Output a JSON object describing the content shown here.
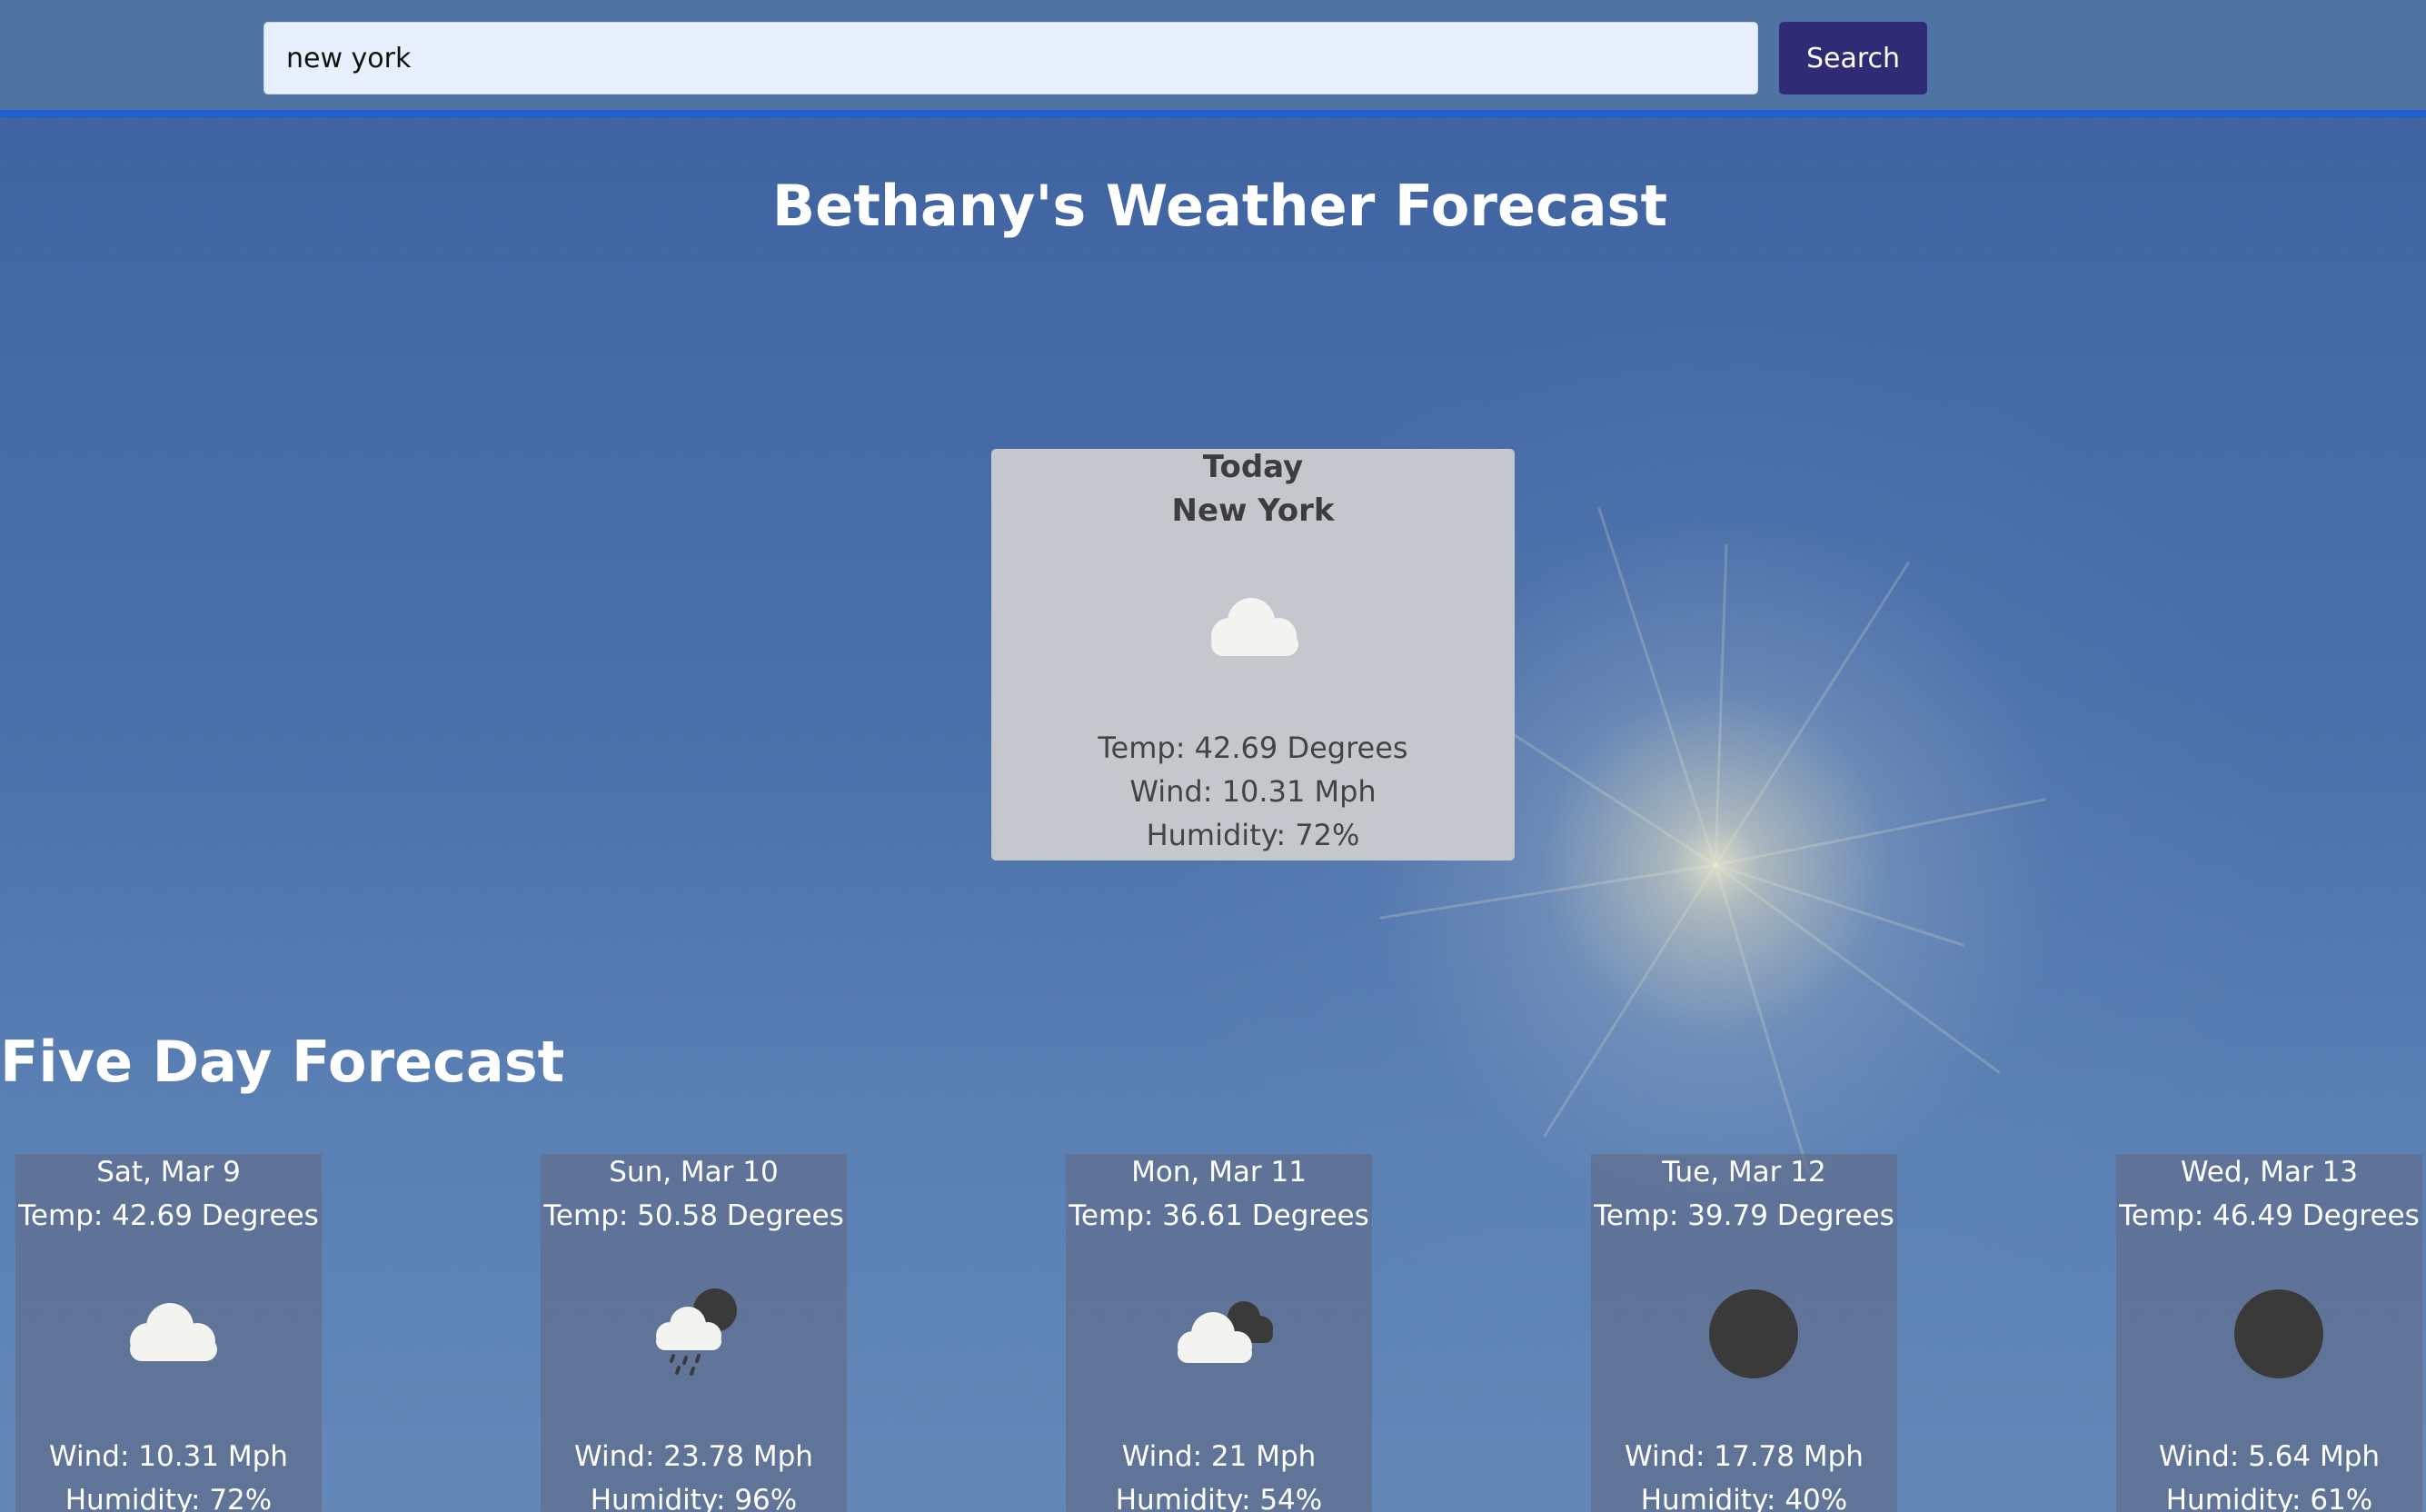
{
  "search": {
    "value": "new york",
    "placeholder": "",
    "button_label": "Search"
  },
  "page_title": "Bethany's Weather Forecast",
  "today": {
    "label": "Today",
    "city": "New York",
    "icon": "cloud-icon",
    "temp": "Temp: 42.69 Degrees",
    "wind": "Wind: 10.31 Mph",
    "humidity": "Humidity: 72%"
  },
  "five_day": {
    "title": "Five Day Forecast",
    "days": [
      {
        "date": "Sat, Mar 9",
        "temp": "Temp: 42.69 Degrees",
        "icon": "cloud-icon",
        "wind": "Wind: 10.31 Mph",
        "humidity": "Humidity: 72%"
      },
      {
        "date": "Sun, Mar 10",
        "temp": "Temp: 50.58 Degrees",
        "icon": "rain-night-icon",
        "wind": "Wind: 23.78 Mph",
        "humidity": "Humidity: 96%"
      },
      {
        "date": "Mon, Mar 11",
        "temp": "Temp: 36.61 Degrees",
        "icon": "broken-clouds-icon",
        "wind": "Wind: 21 Mph",
        "humidity": "Humidity: 54%"
      },
      {
        "date": "Tue, Mar 12",
        "temp": "Temp: 39.79 Degrees",
        "icon": "clear-night-icon",
        "wind": "Wind: 17.78 Mph",
        "humidity": "Humidity: 40%"
      },
      {
        "date": "Wed, Mar 13",
        "temp": "Temp: 46.49 Degrees",
        "icon": "clear-night-icon",
        "wind": "Wind: 5.64 Mph",
        "humidity": "Humidity: 61%"
      }
    ]
  },
  "colors": {
    "header_bg": "#4f73a2",
    "header_border": "#1f5fcf",
    "search_button_bg": "#2f2c75",
    "today_card_bg": "#c4c7cb",
    "forecast_card_bg": "#5f6e8c"
  }
}
